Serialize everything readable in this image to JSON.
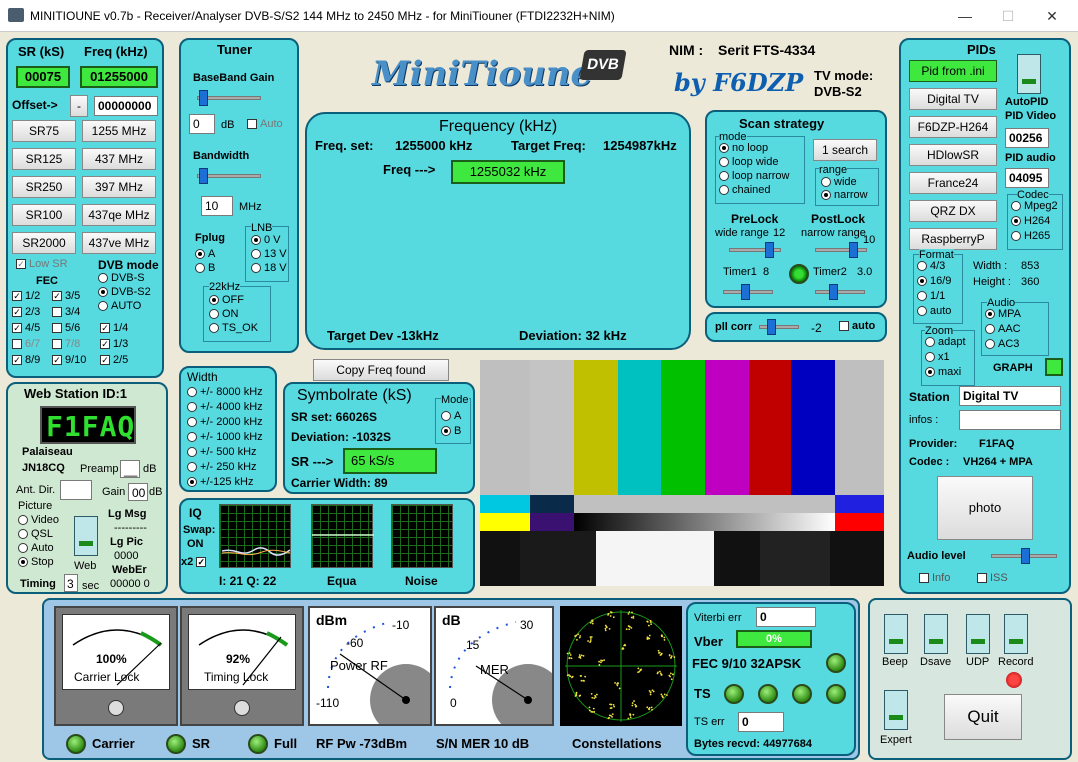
{
  "window": {
    "title": "MINITIOUNE v0.7b - Receiver/Analyser DVB-S/S2 144 MHz to 2450 MHz - for MiniTiouner (FTDI2232H+NIM)"
  },
  "colors": {
    "panel": "#57d9e0",
    "green": "#3ee83e",
    "border": "#0c5f7a"
  },
  "freqpanel": {
    "sr_label": "SR (kS)",
    "freq_label": "Freq (kHz)",
    "sr_value": "00075",
    "freq_value": "01255000",
    "offset_label": "Offset->",
    "offset_sign": "-",
    "offset_value": "00000000",
    "presets": [
      [
        "SR75",
        "1255 MHz"
      ],
      [
        "SR125",
        "437 MHz"
      ],
      [
        "SR250",
        "397 MHz"
      ],
      [
        "SR100",
        "437qe MHz"
      ],
      [
        "SR2000",
        "437ve MHz"
      ]
    ],
    "low_sr": "Low SR",
    "fec_title": "FEC",
    "dvb_mode": "DVB mode",
    "modes": [
      "DVB-S",
      "DVB-S2",
      "AUTO"
    ],
    "fec": [
      [
        "1/2",
        "3/5"
      ],
      [
        "2/3",
        "3/4"
      ],
      [
        "4/5",
        "5/6"
      ],
      [
        "6/7",
        "7/8"
      ],
      [
        "8/9",
        "9/10"
      ]
    ],
    "fec_extra": [
      "1/4",
      "1/3",
      "2/5"
    ]
  },
  "tuner": {
    "title": "Tuner",
    "bb_gain": "BaseBand Gain",
    "gain_value": "0",
    "db": "dB",
    "auto": "Auto",
    "bandwidth": "Bandwidth",
    "bw_value": "10",
    "mhz": "MHz",
    "fplug": "Fplug",
    "fplug_opts": [
      "A",
      "B"
    ],
    "lnb": "LNB",
    "lnb_opts": [
      "0 V",
      "13 V",
      "18 V"
    ],
    "k22": "22kHz",
    "k22_opts": [
      "OFF",
      "ON",
      "TS_OK"
    ]
  },
  "logo": {
    "title": "MiniTioune",
    "dvb": "DVB",
    "by": "by F6DZP"
  },
  "nim": {
    "label": "NIM :",
    "value": "Serit FTS-4334",
    "tvmode_label": "TV mode:",
    "tvmode": "DVB-S2"
  },
  "frequency": {
    "title": "Frequency (kHz)",
    "freq_set_label": "Freq. set:",
    "freq_set": "1255000 kHz",
    "target_label": "Target Freq:",
    "target": "1254987kHz",
    "freq_arrow": "Freq --->",
    "freq_value": "1255032 kHz",
    "target_dev": "Target Dev -13kHz",
    "deviation": "Deviation: 32 kHz"
  },
  "scan": {
    "title": "Scan strategy",
    "mode": "mode",
    "modes": [
      "no loop",
      "loop wide",
      "loop narrow",
      "chained"
    ],
    "search_btn": "1 search",
    "range": "range",
    "ranges": [
      "wide",
      "narrow"
    ],
    "prelock": "PreLock",
    "postlock": "PostLock",
    "wide_range": "wide range",
    "wide_val": "12",
    "narrow_range": "narrow range",
    "narrow_val": "10",
    "timer1": "Timer1",
    "timer1_val": "8",
    "timer2": "Timer2",
    "timer2_val": "3.0",
    "pll": "pll corr",
    "pll_val": "-2",
    "auto": "auto"
  },
  "pids": {
    "title": "PIDs",
    "buttons": [
      "Pid from .ini",
      "Digital TV",
      "F6DZP-H264",
      "HDlowSR",
      "France24",
      "QRZ DX",
      "RaspberryP"
    ],
    "autopid": "AutoPID",
    "pid_video": "PID Video",
    "video_val": "00256",
    "pid_audio": "PID audio",
    "audio_val": "04095",
    "codec": "Codec",
    "codecs": [
      "Mpeg2",
      "H264",
      "H265"
    ],
    "format": "Format",
    "formats": [
      "4/3",
      "16/9",
      "1/1",
      "auto"
    ],
    "width_label": "Width :",
    "width": "853",
    "height_label": "Height :",
    "height": "360",
    "audio": "Audio",
    "audios": [
      "MPA",
      "AAC",
      "AC3"
    ],
    "zoom": "Zoom",
    "zooms": [
      "adapt",
      "x1",
      "maxi"
    ],
    "graph": "GRAPH",
    "station_label": "Station",
    "station": "Digital TV",
    "infos_label": "infos :",
    "provider_label": "Provider:",
    "provider": "F1FAQ",
    "codec_label": "Codec :",
    "codec_val": "VH264 + MPA",
    "photo": "photo",
    "audio_level": "Audio level",
    "info": "Info",
    "iss": "ISS"
  },
  "copy_btn": "Copy Freq found",
  "width_panel": {
    "title": "Width",
    "opts": [
      "+/- 8000 kHz",
      "+/- 4000 kHz",
      "+/- 2000 kHz",
      "+/- 1000 kHz",
      "+/- 500 kHz",
      "+/- 250 kHz",
      "+/-125 kHz"
    ]
  },
  "symbol": {
    "title": "Symbolrate (kS)",
    "sr_set": "SR set:  66026S",
    "deviation": "Deviation: -1032S",
    "sr_arrow": "SR --->",
    "sr_value": "65 kS/s",
    "carrier": "Carrier Width:    89",
    "mode": "Mode",
    "modes": [
      "A",
      "B"
    ]
  },
  "web": {
    "title": "Web Station ID:1",
    "callsign": "F1FAQ",
    "city": "Palaiseau",
    "locator": "JN18CQ",
    "preamp": "Preamp",
    "preamp_val": "__",
    "db": "dB",
    "antdir": "Ant. Dir.",
    "gain": "Gain",
    "gain_val": "00",
    "picture": "Picture",
    "pics": [
      "Video",
      "QSL",
      "Auto",
      "Stop"
    ],
    "web": "Web",
    "lgmsg": "Lg Msg",
    "dashes": "---------",
    "lgpic": "Lg Pic",
    "lgpic_val": "0000",
    "weber": "WebEr",
    "weber_val": "00000  0",
    "timing": "Timing",
    "timing_val": "3",
    "sec": "sec"
  },
  "iq": {
    "title": "IQ",
    "swap": "Swap:",
    "on": "ON",
    "x2": "x2",
    "iq_vals": "I: 21  Q: 22",
    "equa": "Equa",
    "noise": "Noise"
  },
  "meters": {
    "carrier_pct": "100%",
    "carrier_lock": "Carrier Lock",
    "timing_pct": "92%",
    "timing_lock": "Timing Lock",
    "dbm": "dBm",
    "rf_scale": [
      "-60",
      "-10",
      "-110"
    ],
    "power_rf": "Power RF",
    "db": "dB",
    "mer_scale": [
      "15",
      "30",
      "0"
    ],
    "mer": "MER",
    "carrier": "Carrier",
    "sr": "SR",
    "full": "Full",
    "rf_pw": "RF Pw -73dBm",
    "sn_mer": "S/N MER  10 dB",
    "constellations": "Constellations"
  },
  "status": {
    "viterbi": "Viterbi err",
    "viterbi_val": "0",
    "vber": "Vber",
    "vber_val": "0%",
    "fec": "FEC 9/10 32APSK",
    "ts": "TS",
    "ts_err": "TS err",
    "ts_err_val": "0",
    "bytes": "Bytes recvd:  44977684"
  },
  "switches": {
    "beep": "Beep",
    "dsave": "Dsave",
    "udp": "UDP",
    "record": "Record",
    "expert": "Expert",
    "quit": "Quit"
  }
}
